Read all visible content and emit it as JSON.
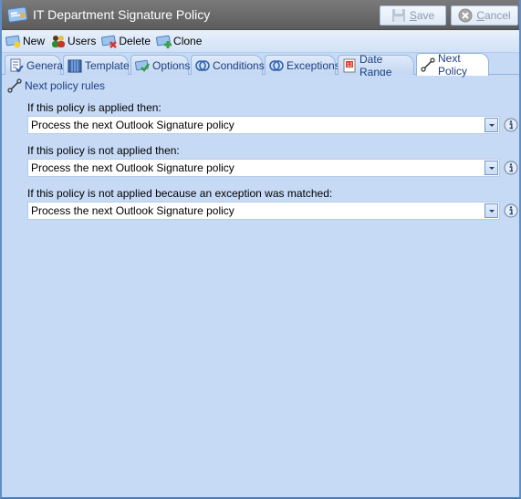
{
  "window": {
    "title": "IT Department Signature Policy",
    "save_label": "Save",
    "save_underline": "S",
    "save_rest": "ave",
    "cancel_underline": "C",
    "cancel_rest": "ancel"
  },
  "toolbar": {
    "items": [
      {
        "label": "New",
        "icon": "new-policy-icon"
      },
      {
        "label": "Users",
        "icon": "users-icon"
      },
      {
        "label": "Delete",
        "icon": "delete-policy-icon"
      },
      {
        "label": "Clone",
        "icon": "clone-policy-icon"
      }
    ]
  },
  "tabs": [
    {
      "label": "General",
      "icon": "general-icon"
    },
    {
      "label": "Template",
      "icon": "template-icon"
    },
    {
      "label": "Options",
      "icon": "options-icon"
    },
    {
      "label": "Conditions",
      "icon": "conditions-icon"
    },
    {
      "label": "Exceptions",
      "icon": "exceptions-icon"
    },
    {
      "label": "Date Range",
      "icon": "calendar-icon"
    },
    {
      "label": "Next Policy",
      "icon": "next-policy-icon",
      "active": true
    }
  ],
  "content": {
    "section_title": "Next policy rules",
    "fields": [
      {
        "label": "If this policy is applied then:",
        "value": "Process the next Outlook Signature policy"
      },
      {
        "label": "If this policy is not applied then:",
        "value": "Process the next Outlook Signature policy"
      },
      {
        "label": "If this policy is not applied because an exception was matched:",
        "value": "Process the next Outlook Signature policy"
      }
    ]
  },
  "colors": {
    "titlebar": "#666666",
    "panel_bg": "#c6daf6",
    "tab_text": "#1e3f80"
  }
}
